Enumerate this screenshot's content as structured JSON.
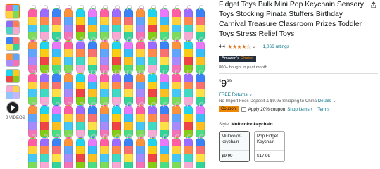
{
  "thumbnails": {
    "videos_label": "2 VIDEOS"
  },
  "product": {
    "title": "Fidget Toys Bulk Mini Pop Keychain Sensory Toys Stocking Pinata Stuffers Birthday Carnival Treasure Classroom Prizes Toddler Toys Stress Relief Toys",
    "rating_value": "4.4",
    "stars_icon": "★★★★☆",
    "rating_count": "1,066 ratings",
    "badge_prefix": "Amazon's",
    "badge_suffix": "Choice",
    "bought": "800+ bought in past month",
    "price_currency": "$",
    "price_whole": "9",
    "price_fraction": "99",
    "free_returns": "FREE Returns",
    "import_text": "No Import Fees Deposit & $9.95 Shipping to China",
    "import_link": "Details",
    "coupon_tag": "Coupon:",
    "coupon_apply": "Apply 20% coupon",
    "shop_items": "Shop items",
    "terms": "Terms",
    "style_label": "Style:",
    "style_value": "Multicolor-keychain",
    "options": [
      {
        "name": "Multicolor-keychain",
        "price": "$9.99"
      },
      {
        "name": "Pop Fidget Keychain",
        "price": "$17.99"
      }
    ]
  },
  "colors": {
    "accent_orange": "#f08804",
    "link": "#007185",
    "badge_bg": "#232f3e",
    "star": "#de7921"
  }
}
